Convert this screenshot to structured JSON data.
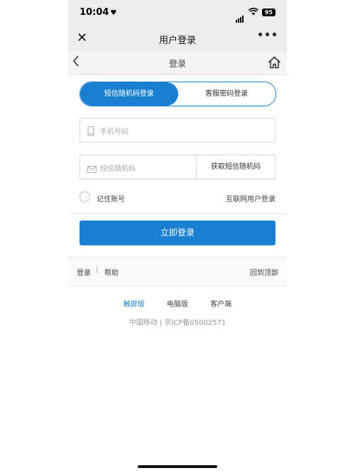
{
  "status_bar": {
    "time": "10:04",
    "battery": "95"
  },
  "wechat_nav": {
    "title": "用户登录",
    "close": "✕",
    "more": "•••"
  },
  "header": {
    "title": "登录"
  },
  "tabs": [
    {
      "label": "短信随机码登录",
      "active": true
    },
    {
      "label": "客服密码登录",
      "active": false
    }
  ],
  "phone_field": {
    "placeholder": "手机号码"
  },
  "sms_field": {
    "placeholder": "短信随机码",
    "button": "获取短信随机码"
  },
  "remember": {
    "label": "记住账号",
    "link": "互联网用户登录"
  },
  "login_button": "立即登录",
  "footer": {
    "login": "登录",
    "separator": "|",
    "help": "帮助",
    "back_to_top": "回到顶部"
  },
  "versions": {
    "touch": "触屏版",
    "pc": "电脑版",
    "client": "客户端"
  },
  "copyright": "中国移动 | 京ICP备05002571",
  "colors": {
    "accent": "#1a7fd1"
  }
}
